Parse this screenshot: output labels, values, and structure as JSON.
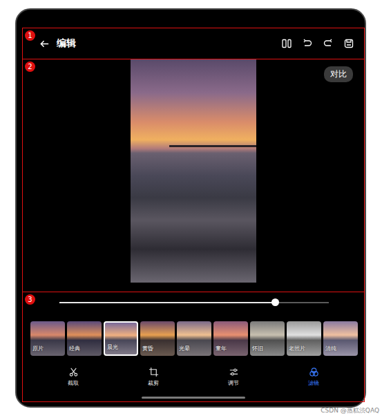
{
  "annotations": [
    {
      "number": "1"
    },
    {
      "number": "2"
    },
    {
      "number": "3"
    }
  ],
  "topbar": {
    "title": "编辑"
  },
  "compare_button": {
    "label": "对比"
  },
  "slider": {
    "level": 0.8
  },
  "filters": [
    {
      "label": "原片",
      "selected": false
    },
    {
      "label": "经典",
      "selected": false
    },
    {
      "label": "晨光",
      "selected": true
    },
    {
      "label": "黄昏",
      "selected": false
    },
    {
      "label": "光晕",
      "selected": false
    },
    {
      "label": "童年",
      "selected": false
    },
    {
      "label": "怀旧",
      "selected": false
    },
    {
      "label": "老照片",
      "selected": false
    },
    {
      "label": "清纯",
      "selected": false
    }
  ],
  "tools": [
    {
      "label": "截取",
      "selected": false
    },
    {
      "label": "裁剪",
      "selected": false
    },
    {
      "label": "调节",
      "selected": false
    },
    {
      "label": "滤镜",
      "selected": true
    }
  ],
  "watermark": "CSDN @蒸糕渋QAQ"
}
